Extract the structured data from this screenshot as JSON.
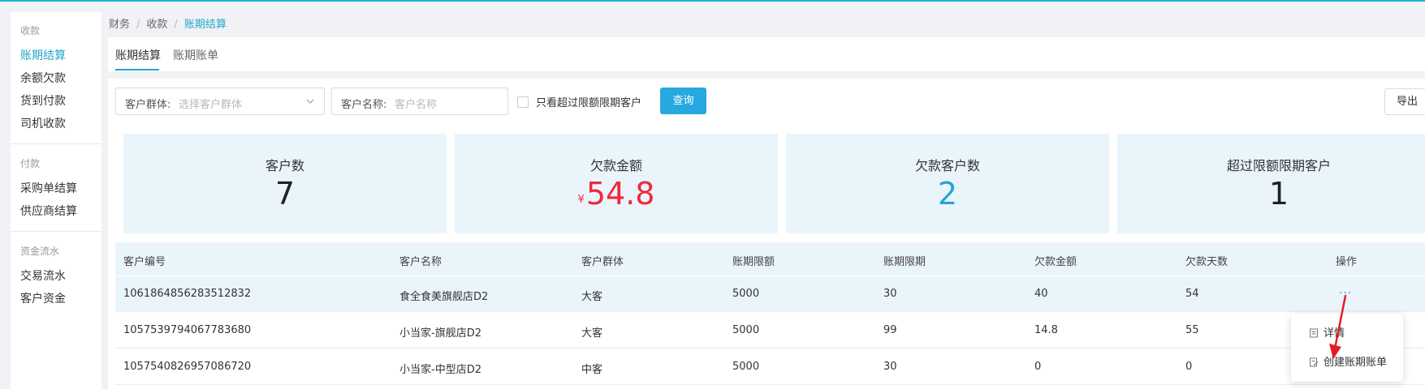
{
  "breadcrumb": {
    "items": [
      "财务",
      "收款",
      "账期结算"
    ]
  },
  "sidebar": {
    "groups": [
      {
        "title": "收款",
        "items": [
          "账期结算",
          "余额欠款",
          "货到付款",
          "司机收款"
        ]
      },
      {
        "title": "付款",
        "items": [
          "采购单结算",
          "供应商结算"
        ]
      },
      {
        "title": "资金流水",
        "items": [
          "交易流水",
          "客户资金"
        ]
      }
    ],
    "active_item": "账期结算"
  },
  "tabs": [
    "账期结算",
    "账期账单"
  ],
  "filters": {
    "group_label": "客户群体:",
    "group_placeholder": "选择客户群体",
    "name_label": "客户名称:",
    "name_placeholder": "客户名称",
    "only_over_label": "只看超过限额限期客户",
    "only_over_checked": false,
    "query_button": "查询",
    "export_button": "导出"
  },
  "stats": [
    {
      "label": "客户数",
      "value": "7"
    },
    {
      "label": "欠款金额",
      "prefix": "¥",
      "value": "54.8"
    },
    {
      "label": "欠款客户数",
      "value": "2"
    },
    {
      "label": "超过限额限期客户",
      "value": "1"
    }
  ],
  "table": {
    "columns": [
      "客户编号",
      "客户名称",
      "客户群体",
      "账期限额",
      "账期限期",
      "欠款金额",
      "欠款天数",
      "操作"
    ],
    "rows": [
      [
        "1061864856283512832",
        "食全食美旗舰店D2",
        "大客",
        "5000",
        "30",
        "40",
        "54"
      ],
      [
        "1057539794067783680",
        "小当家-旗舰店D2",
        "大客",
        "5000",
        "99",
        "14.8",
        "55"
      ],
      [
        "1057540826957086720",
        "小当家-中型店D2",
        "中客",
        "5000",
        "30",
        "0",
        "0"
      ]
    ],
    "row_action": "···"
  },
  "action_menu": {
    "items": [
      "详情",
      "创建账期账单"
    ]
  },
  "colors": {
    "accent": "#21a7cd",
    "card_bg": "#eaf5fb",
    "debt_red": "#f0283c",
    "button_blue": "#26a9e0",
    "arrow_red": "#e51c23"
  }
}
